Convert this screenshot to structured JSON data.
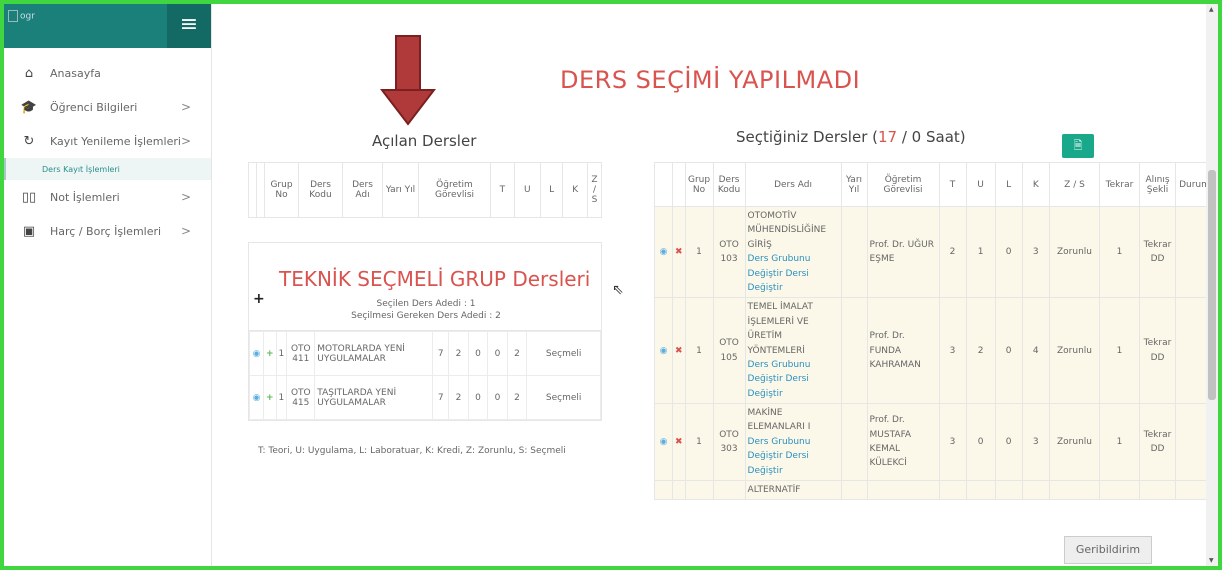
{
  "sidebar": {
    "logo_alt": "ogr",
    "items": [
      {
        "label": "Anasayfa",
        "icon": "home-icon",
        "chev": ""
      },
      {
        "label": "Öğrenci Bilgileri",
        "icon": "graduation-cap-icon",
        "chev": ">"
      },
      {
        "label": "Kayıt Yenileme İşlemleri",
        "icon": "refresh-icon",
        "chev": ">"
      },
      {
        "label": "Not İşlemleri",
        "icon": "book-icon",
        "chev": ">"
      },
      {
        "label": "Harç / Borç İşlemleri",
        "icon": "money-icon",
        "chev": ">"
      }
    ],
    "sub_item": "Ders Kayıt İşlemleri"
  },
  "warning": "DERS SEÇİMİ YAPILMADI",
  "acilan": {
    "title": "Açılan Dersler",
    "headers": [
      "Grup No",
      "Ders Kodu",
      "Ders Adı",
      "Yarı Yıl",
      "Öğretim Görevlisi",
      "T",
      "U",
      "L",
      "K",
      "Z / S"
    ]
  },
  "teknik": {
    "title": "TEKNİK SEÇMELİ GRUP Dersleri",
    "secilen": "Seçilen Ders Adedi : 1",
    "secilmesi": "Seçilmesi Gereken Ders Adedi : 2",
    "rows": [
      {
        "grup": "1",
        "kod": "OTO 411",
        "ad": "MOTORLARDA YENİ UYGULAMALAR",
        "yy": "7",
        "t": "2",
        "u": "0",
        "l": "0",
        "k": "2",
        "zs": "Seçmeli"
      },
      {
        "grup": "1",
        "kod": "OTO 415",
        "ad": "TAŞITLARDA YENİ UYGULAMALAR",
        "yy": "7",
        "t": "2",
        "u": "0",
        "l": "0",
        "k": "2",
        "zs": "Seçmeli"
      }
    ]
  },
  "legend": "T: Teori, U: Uygulama, L: Laboratuar, K: Kredi, Z: Zorunlu, S: Seçmeli",
  "secilen": {
    "title_pre": "Seçtiğiniz Dersler (",
    "count": "17",
    "title_post": " / 0 Saat)",
    "headers": [
      "Grup No",
      "Ders Kodu",
      "Ders Adı",
      "Yarı Yıl",
      "Öğretim Görevlisi",
      "T",
      "U",
      "L",
      "K",
      "Z / S",
      "Tekrar",
      "Alınış Şekli",
      "Durum"
    ],
    "link_group": "Ders Grubunu",
    "link_change": "Değiştir Dersi Değiştir",
    "rows": [
      {
        "grup": "1",
        "kod": "OTO 103",
        "ad": "OTOMOTİV MÜHENDİSLİĞİNE GİRİŞ",
        "hoca": "Prof. Dr. UĞUR EŞME",
        "t": "2",
        "u": "1",
        "l": "0",
        "k": "3",
        "zs": "Zorunlu",
        "tekrar": "1",
        "alinis": "Tekrar DD"
      },
      {
        "grup": "1",
        "kod": "OTO 105",
        "ad": "TEMEL İMALAT İŞLEMLERİ VE ÜRETİM YÖNTEMLERİ",
        "hoca": "Prof. Dr. FUNDA KAHRAMAN",
        "t": "3",
        "u": "2",
        "l": "0",
        "k": "4",
        "zs": "Zorunlu",
        "tekrar": "1",
        "alinis": "Tekrar DD"
      },
      {
        "grup": "1",
        "kod": "OTO 303",
        "ad": "MAKİNE ELEMANLARI I",
        "hoca": "Prof. Dr. MUSTAFA KEMAL KÜLEKCİ",
        "t": "3",
        "u": "0",
        "l": "0",
        "k": "3",
        "zs": "Zorunlu",
        "tekrar": "1",
        "alinis": "Tekrar DD"
      }
    ],
    "partial_row": "ALTERNATİF"
  },
  "feedback": "Geribildirim"
}
